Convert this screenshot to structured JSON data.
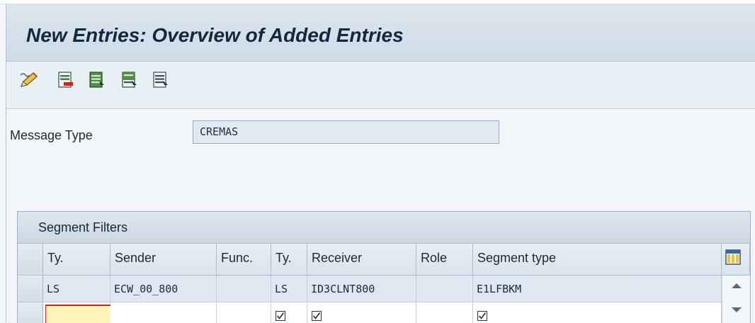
{
  "screen": {
    "title": "New Entries: Overview of Added Entries"
  },
  "toolbar": {
    "icons": [
      "edit-pencil-icon",
      "delete-row-icon",
      "select-all-icon",
      "select-block-icon",
      "deselect-all-icon"
    ]
  },
  "form": {
    "message_type_label": "Message Type",
    "message_type_value": "CREMAS"
  },
  "segment_filters": {
    "title": "Segment Filters",
    "columns": [
      "Ty.",
      "Sender",
      "Func.",
      "Ty.",
      "Receiver",
      "Role",
      "Segment type"
    ],
    "rows": [
      {
        "sender_type": "LS",
        "sender": "ECW_00_800",
        "function": "",
        "receiver_type": "LS",
        "receiver": "ID3CLNT800",
        "role": "",
        "segment_type": "E1LFBKM"
      },
      {
        "sender_type": "",
        "sender": "",
        "function": "",
        "receiver_type": "",
        "receiver": "",
        "role": "",
        "segment_type": ""
      }
    ]
  },
  "colors": {
    "accent": "#10293f",
    "highlight_input": "#fff3b8",
    "header_bg": "#cfdbe6"
  }
}
